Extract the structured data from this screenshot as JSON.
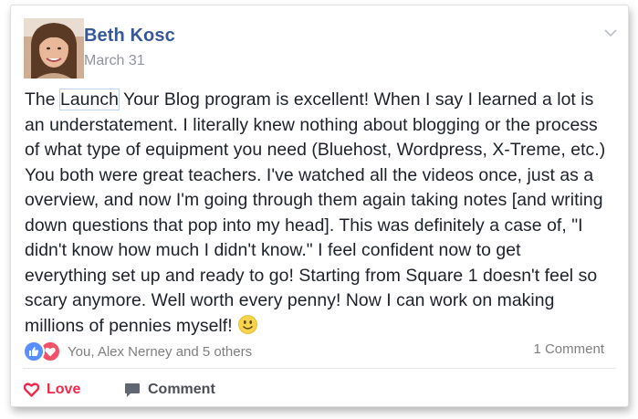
{
  "post": {
    "author": "Beth Kosc",
    "date": "March 31",
    "text_lines": [
      "The ",
      "Launch",
      " Your Blog program is excellent! When I say I learned a lot is",
      "an understatement. I literally knew nothing about blogging or the process",
      "of what type of equipment you need (Bluehost, Wordpress, X-Treme, etc.)",
      "You both were great teachers. I've watched all the videos once, just as a",
      "overview, and now I'm going through them again taking notes [and writing",
      "down questions that pop into my head]. This was definitely a case of, \"I",
      "didn't know how much I didn't know.\" I feel confident now to get",
      "everything set up and ready to go! Starting from Square 1 doesn't feel so",
      "scary anymore. Well worth every penny! Now I can work on making",
      "millions of pennies myself!"
    ]
  },
  "footer": {
    "reactors": "You, Alex Nerney and 5 others",
    "comment_count": "1 Comment"
  },
  "actions": {
    "love_label": "Love",
    "comment_label": "Comment"
  },
  "icons": {
    "like": "like-icon",
    "love": "love-icon",
    "smile": "smile-emoji-icon",
    "chevron": "chevron-down-icon",
    "heart_outline": "heart-outline-icon",
    "speech_bubble": "speech-bubble-icon"
  },
  "colors": {
    "author_blue": "#365899",
    "love_red": "#f0284a",
    "like_blue": "#5890ff",
    "meta_gray": "#90949c"
  }
}
